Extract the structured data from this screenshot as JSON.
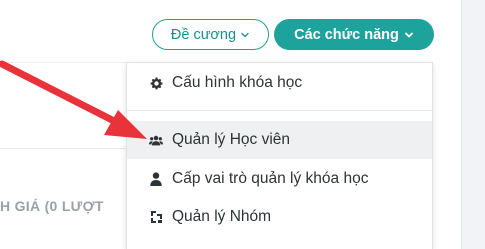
{
  "header": {
    "outline_button_label": "Đề cương",
    "solid_button_label": "Các chức năng"
  },
  "menu": {
    "items": [
      {
        "label": "Cấu hình khóa học",
        "icon": "gear-icon"
      },
      {
        "label": "Quản lý Học viên",
        "icon": "users-icon"
      },
      {
        "label": "Cấp vai trò quản lý khóa học",
        "icon": "user-icon"
      },
      {
        "label": "Quản lý Nhóm",
        "icon": "group-icon"
      }
    ]
  },
  "background": {
    "rating_text": "H GIÁ (0 LƯỢT"
  },
  "colors": {
    "accent": "#1ea39c",
    "arrow": "#e8333b",
    "hover_bg": "#eef0f2"
  }
}
